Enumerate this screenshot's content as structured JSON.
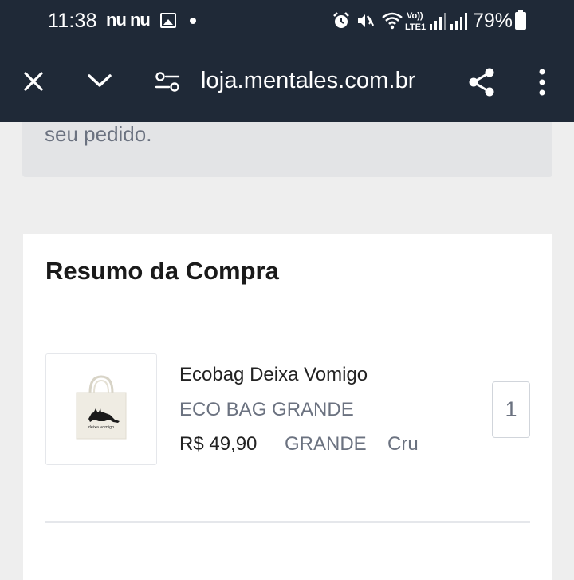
{
  "status_bar": {
    "time": "11:38",
    "notifications": "nu nu",
    "battery": "79%",
    "network": "LTE1"
  },
  "browser": {
    "url": "loja.mentales.com.br"
  },
  "notice": {
    "text": "seu pedido."
  },
  "summary": {
    "title": "Resumo da Compra",
    "items": [
      {
        "name": "Ecobag Deixa Vomigo",
        "variant": "ECO BAG GRANDE",
        "price": "R$ 49,90",
        "size": "GRANDE",
        "color": "Cru",
        "quantity": "1",
        "image_caption": "deixa vomigo"
      }
    ]
  }
}
